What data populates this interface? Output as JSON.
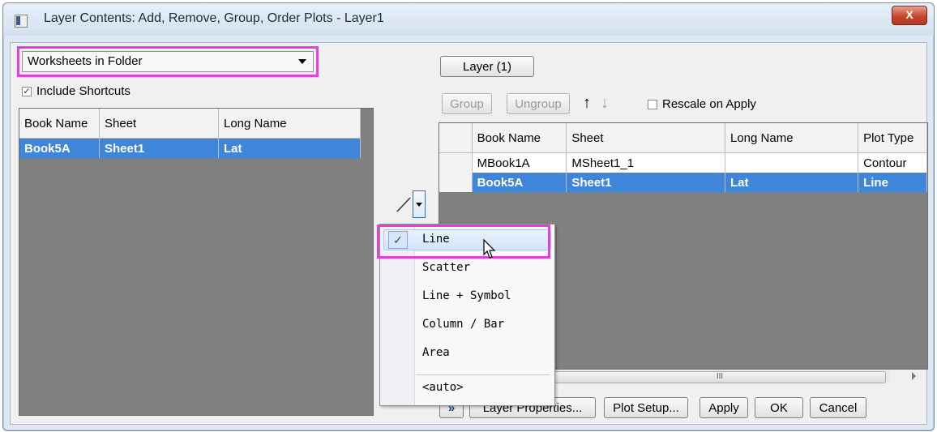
{
  "window": {
    "title": "Layer Contents: Add, Remove, Group, Order Plots - Layer1",
    "close_glyph": "X"
  },
  "left_panel": {
    "source_select": {
      "value": "Worksheets in Folder"
    },
    "include_shortcuts": {
      "label": "Include Shortcuts",
      "checked": true
    },
    "columns": [
      "Book Name",
      "Sheet",
      "Long Name"
    ],
    "rows": [
      {
        "book": "Book5A",
        "sheet": "Sheet1",
        "long_name": "Lat"
      }
    ]
  },
  "plot_type_menu": {
    "items": [
      "Line",
      "Scatter",
      "Line + Symbol",
      "Column / Bar",
      "Area",
      "<auto>"
    ],
    "selected": "Line"
  },
  "right_panel": {
    "layer_tab": "Layer (1)",
    "group_button": "Group",
    "ungroup_button": "Ungroup",
    "rescale_label": "Rescale on Apply",
    "columns": [
      "Book Name",
      "Sheet",
      "Long Name",
      "Plot Type"
    ],
    "rows": [
      {
        "book": "MBook1A",
        "sheet": "MSheet1_1",
        "long_name": "",
        "plot_type": "Contour"
      },
      {
        "book": "Book5A",
        "sheet": "Sheet1",
        "long_name": "Lat",
        "plot_type": "Line"
      }
    ],
    "scroll_marker": "III"
  },
  "footer": {
    "collapse_glyph": "»",
    "layer_properties": "Layer Properties...",
    "plot_setup": "Plot Setup...",
    "apply": "Apply",
    "ok": "OK",
    "cancel": "Cancel"
  },
  "colors": {
    "highlight": "#e83be0",
    "selection": "#3f85d9"
  }
}
